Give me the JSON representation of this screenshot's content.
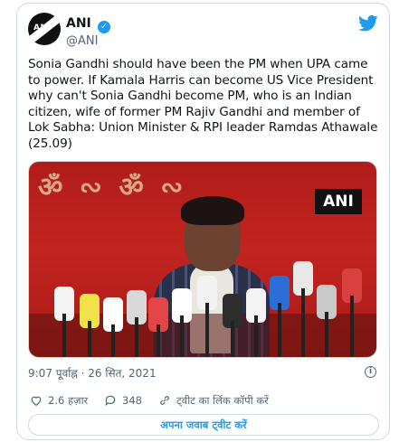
{
  "account": {
    "display_name": "ANI",
    "handle": "@ANI",
    "avatar_text": "ANI",
    "verified": true
  },
  "tweet": {
    "text": "Sonia Gandhi should have been the PM when UPA came to power. If Kamala Harris can become US Vice President why can't Sonia Gandhi become PM, who is an Indian citizen, wife of former PM Rajiv Gandhi and member of Lok Sabha: Union Minister & RPI leader Ramdas Athawale (25.09)"
  },
  "media": {
    "watermark": "ANI"
  },
  "meta": {
    "timestamp": "9:07 पूर्वाह्न · 26 सित, 2021"
  },
  "actions": {
    "like_count": "2.6 हज़ार",
    "reply_count": "348",
    "copy_link_label": "ट्वीट का लिंक कॉपी करें"
  },
  "reply_button_label": "अपना जवाब ट्वीट करें",
  "colors": {
    "accent": "#1d9bf0",
    "text_secondary": "#536471",
    "border": "#cfd9de"
  },
  "icons": [
    "twitter-bird-icon",
    "verified-badge-icon",
    "info-icon",
    "heart-icon",
    "reply-icon",
    "link-icon"
  ]
}
